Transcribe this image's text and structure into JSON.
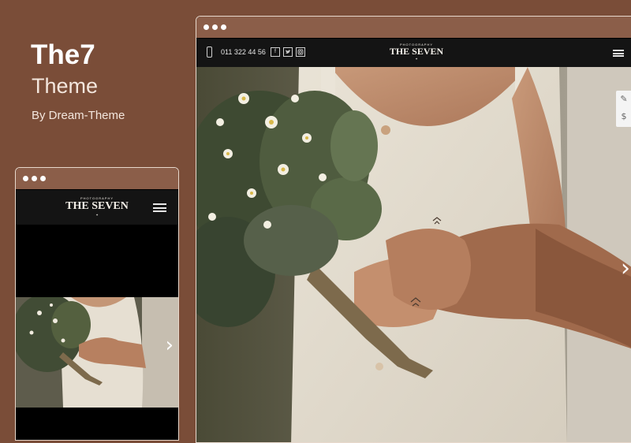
{
  "hero": {
    "title": "The7",
    "subtitle": "Theme",
    "byline": "By Dream-Theme"
  },
  "desktop": {
    "phone_number": "011 322 44 56",
    "social": [
      "f",
      "t",
      "ig"
    ],
    "logo": {
      "tagline": "PHOTOGRAPHY",
      "name": "THE SEVEN",
      "ornament": "✦"
    },
    "menu_icon": "hamburger-icon",
    "side_tools": [
      "wrench-icon",
      "dollar-icon"
    ],
    "next_arrow": "›"
  },
  "mobile": {
    "logo": {
      "tagline": "PHOTOGRAPHY",
      "name": "THE SEVEN",
      "ornament": "✦"
    },
    "menu_icon": "hamburger-icon",
    "next_arrow": "›"
  },
  "colors": {
    "background": "#7a4d38",
    "chrome": "#8b5e49",
    "header": "#141414"
  }
}
